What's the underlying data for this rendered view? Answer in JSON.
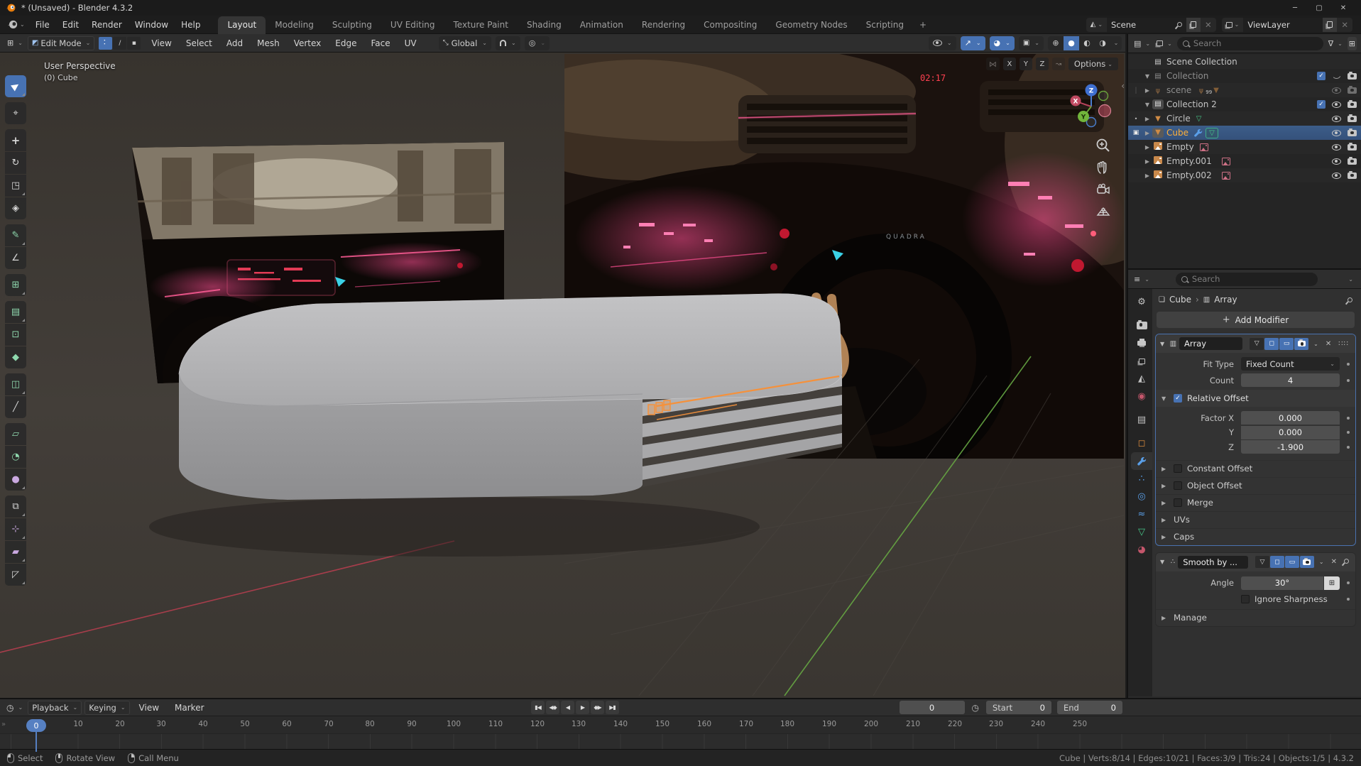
{
  "window": {
    "title": "* (Unsaved) - Blender 4.3.2"
  },
  "menubar": [
    "File",
    "Edit",
    "Render",
    "Window",
    "Help"
  ],
  "workspaces": [
    "Layout",
    "Modeling",
    "Sculpting",
    "UV Editing",
    "Texture Paint",
    "Shading",
    "Animation",
    "Rendering",
    "Compositing",
    "Geometry Nodes",
    "Scripting"
  ],
  "workspace_add": "+",
  "scene_bar": {
    "scene": "Scene",
    "view_layer": "ViewLayer"
  },
  "viewport_header": {
    "mode": "Edit Mode",
    "menus": [
      "View",
      "Select",
      "Add",
      "Mesh",
      "Vertex",
      "Edge",
      "Face",
      "UV"
    ],
    "orientation": "Global"
  },
  "viewport": {
    "overlay_line1": "User Perspective",
    "overlay_line2": "(0) Cube",
    "axis_x": "X",
    "axis_y": "Y",
    "axis_z": "Z",
    "options_label": "Options",
    "gizmo_x": "X",
    "gizmo_y": "Y",
    "gizmo_z": "Z",
    "scene_clock": "02:17",
    "scene_brand": "QUADRA"
  },
  "toolbar_tools": [
    "select-box",
    "cursor",
    "move",
    "rotate",
    "scale",
    "transform",
    "annotate",
    "measure",
    "add-cube",
    "extrude-region",
    "inset-faces",
    "bevel",
    "loop-cut",
    "knife",
    "poly-build",
    "spin",
    "smooth",
    "edge-slide",
    "shrink-fatten",
    "shear",
    "rip-region"
  ],
  "outliner": {
    "search_placeholder": "Search",
    "rows": [
      {
        "label": "Scene Collection"
      },
      {
        "label": "Collection"
      },
      {
        "label": "scene",
        "badge": "99"
      },
      {
        "label": "Collection 2"
      },
      {
        "label": "Circle"
      },
      {
        "label": "Cube"
      },
      {
        "label": "Empty"
      },
      {
        "label": "Empty.001"
      },
      {
        "label": "Empty.002"
      }
    ]
  },
  "properties": {
    "search_placeholder": "Search",
    "breadcrumb_object": "Cube",
    "breadcrumb_separator": "›",
    "breadcrumb_modifier": "Array",
    "add_modifier": "Add Modifier",
    "array": {
      "name": "Array",
      "fit_type_label": "Fit Type",
      "fit_type_value": "Fixed Count",
      "count_label": "Count",
      "count_value": "4",
      "relative_offset": "Relative Offset",
      "factor_x_label": "Factor X",
      "factor_x": "0.000",
      "y_label": "Y",
      "factor_y": "0.000",
      "z_label": "Z",
      "factor_z": "-1.900",
      "constant_offset": "Constant Offset",
      "object_offset": "Object Offset",
      "merge": "Merge",
      "uvs": "UVs",
      "caps": "Caps"
    },
    "smooth": {
      "name": "Smooth by ...",
      "angle_label": "Angle",
      "angle_value": "30°",
      "ignore_sharpness": "Ignore Sharpness",
      "manage": "Manage"
    }
  },
  "timeline": {
    "menus": [
      "Playback",
      "Keying",
      "View",
      "Marker"
    ],
    "ticks": [
      "0",
      "10",
      "20",
      "30",
      "40",
      "50",
      "60",
      "70",
      "80",
      "90",
      "100",
      "110",
      "120",
      "130",
      "140",
      "150",
      "160",
      "170",
      "180",
      "190",
      "200",
      "210",
      "220",
      "230",
      "240",
      "250"
    ],
    "current_frame": "0",
    "start_label": "Start",
    "start_value": "0",
    "end_label": "End",
    "end_value": "0"
  },
  "statusbar": {
    "hint_select": "Select",
    "hint_rotate": "Rotate View",
    "hint_menu": "Call Menu",
    "stats": "Cube | Verts:8/14 | Edges:10/21 | Faces:3/9 | Tris:24 | Objects:1/5 | 4.3.2"
  },
  "colors": {
    "accent": "#4772b3",
    "selected_text": "#ffb039",
    "object_orange": "#cf8b45",
    "mesh_green": "#46c688",
    "image_pink": "#cf7186",
    "highlight_orange": "#f5913b"
  }
}
